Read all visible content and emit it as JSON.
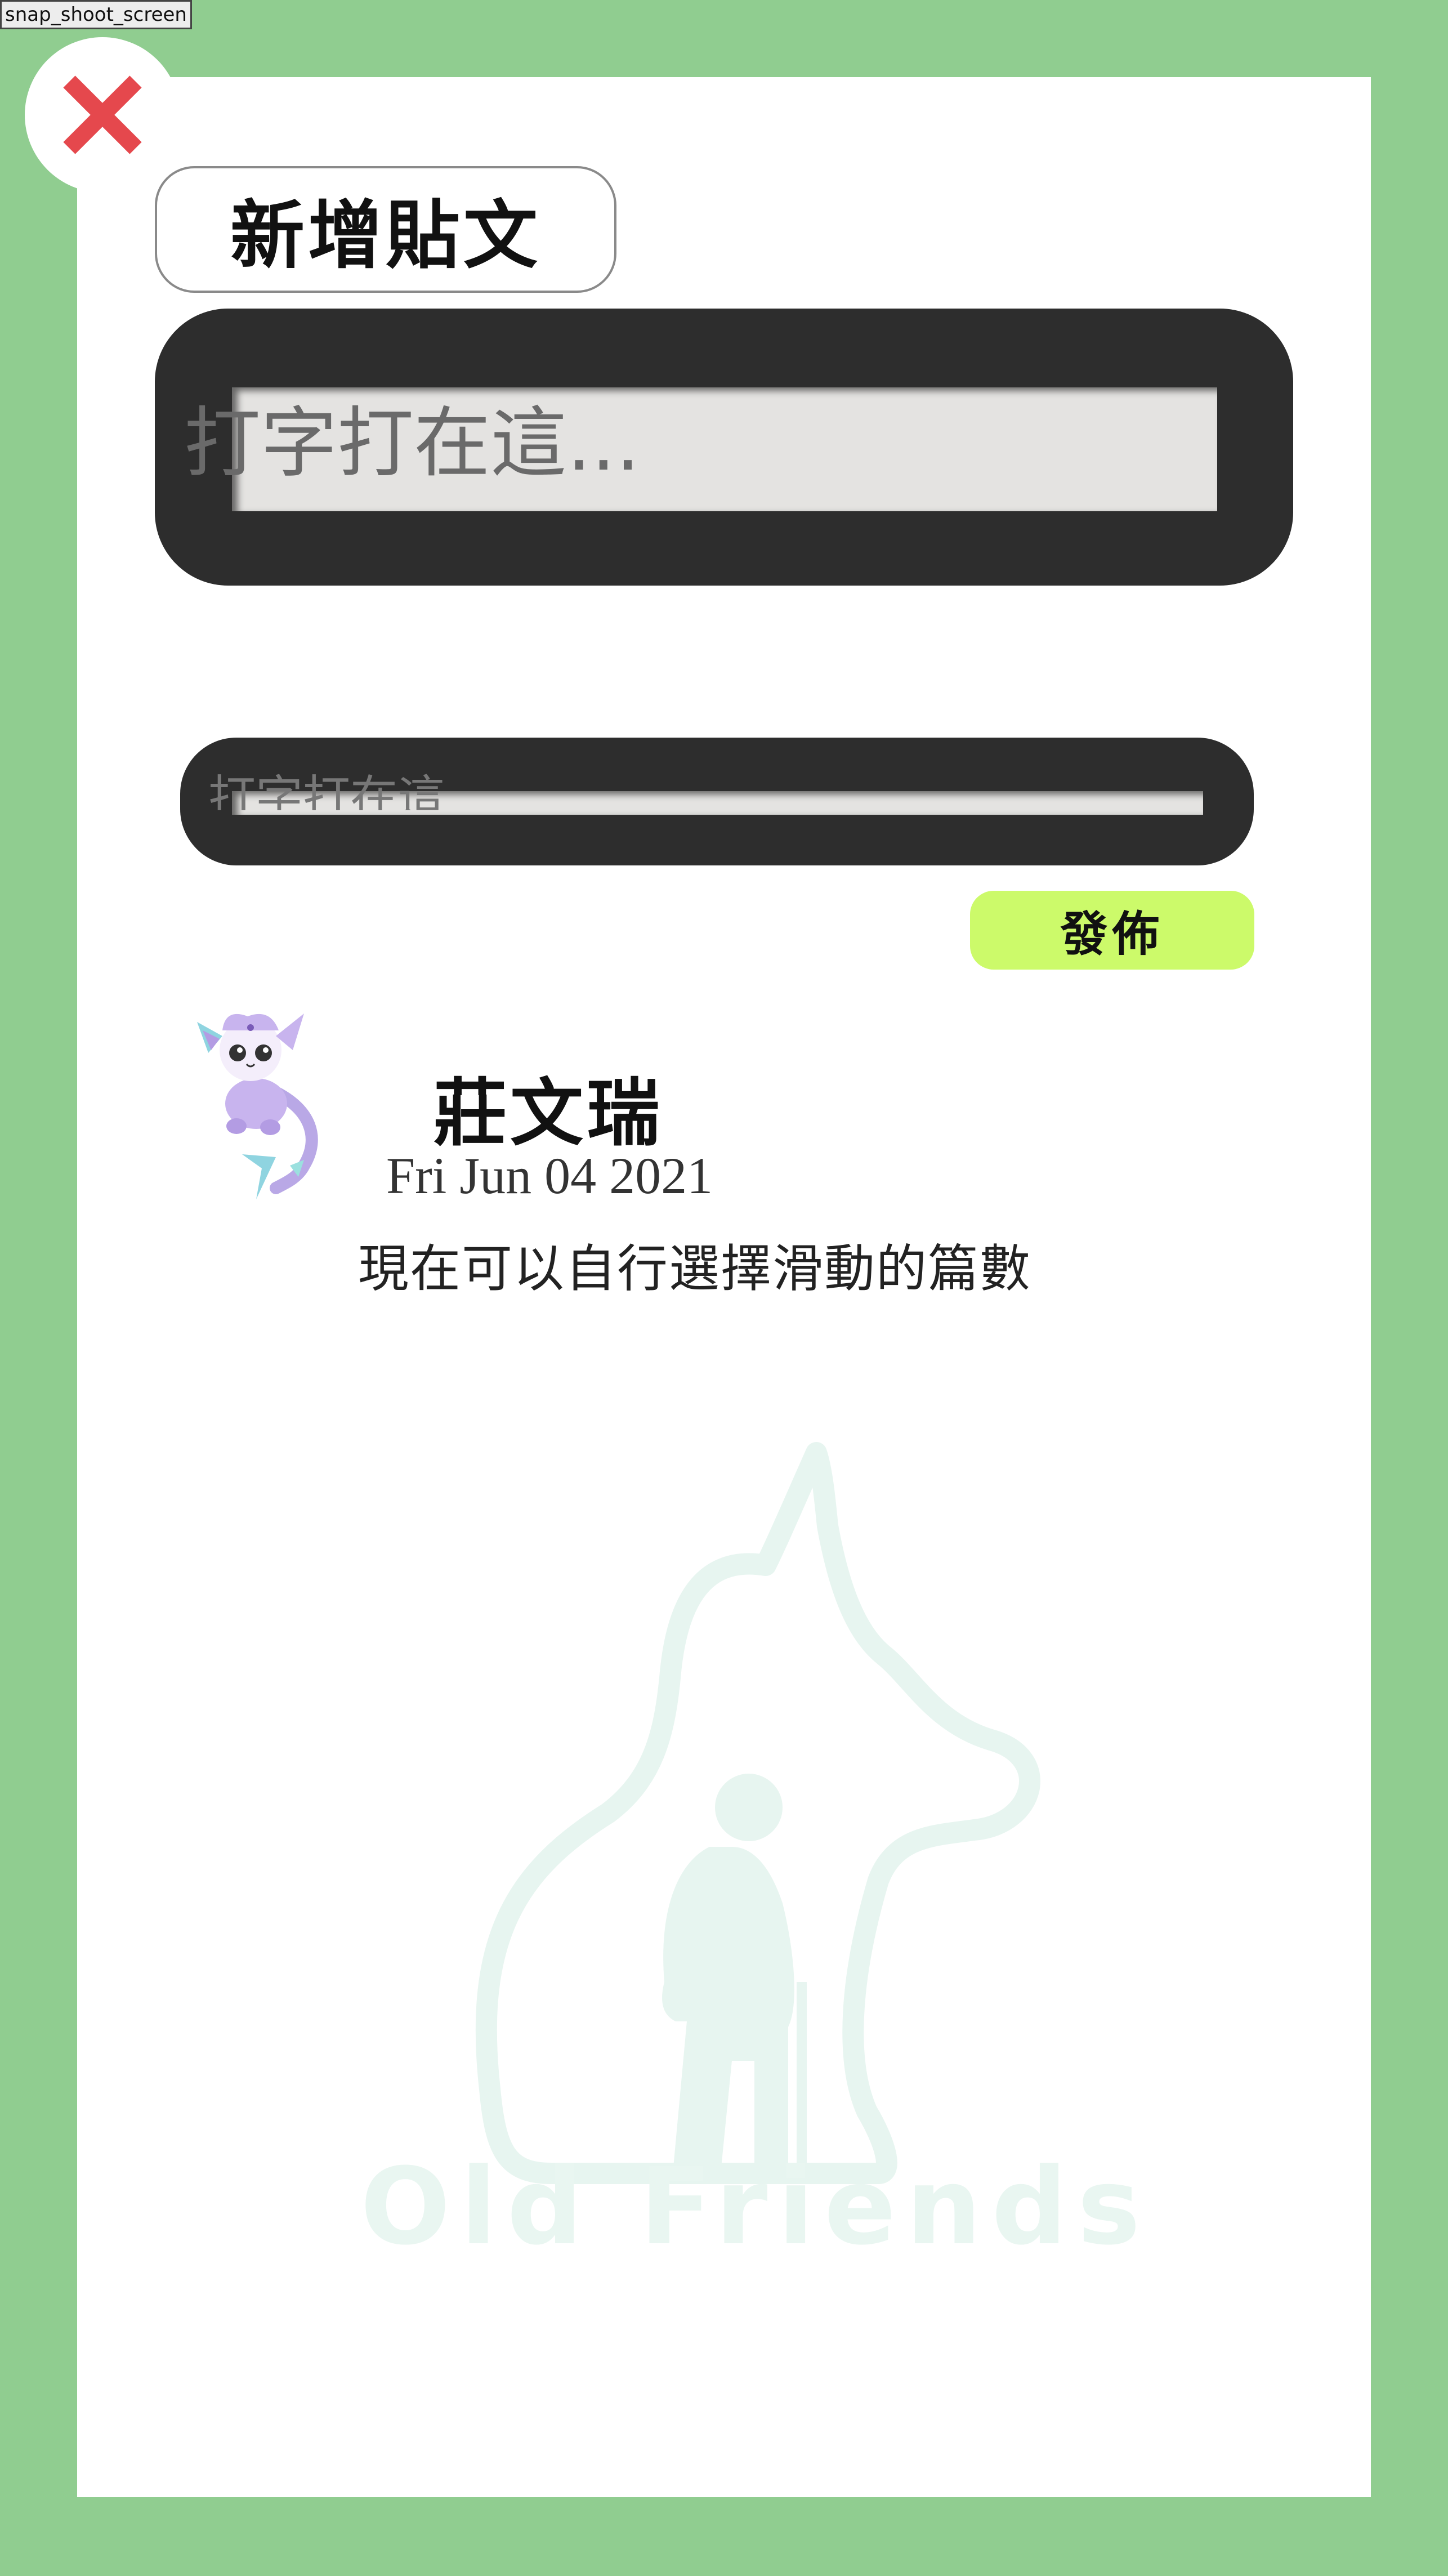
{
  "toolbar": {
    "snapshot_label": "snap_shoot_screen"
  },
  "colors": {
    "background": "#90cd90",
    "card": "#ffffff",
    "close_x": "#e5484d",
    "publish_button": "#ccfa6a",
    "input_frame": "#2d2d2d",
    "watermark": "#e9f6f1"
  },
  "header": {
    "title": "新增貼文",
    "close_icon": "close-x-icon"
  },
  "composer": {
    "main_placeholder": "打字打在這...",
    "secondary_placeholder": "打字打在這",
    "publish_label": "發佈"
  },
  "post": {
    "author": "莊文瑞",
    "date": "Fri Jun 04 2021",
    "content": "現在可以自行選擇滑動的篇數",
    "avatar_icon": "purple-cat-mermaid-avatar"
  },
  "watermark": {
    "text": "Old Friends",
    "icon": "cat-and-elder-silhouette-logo"
  }
}
